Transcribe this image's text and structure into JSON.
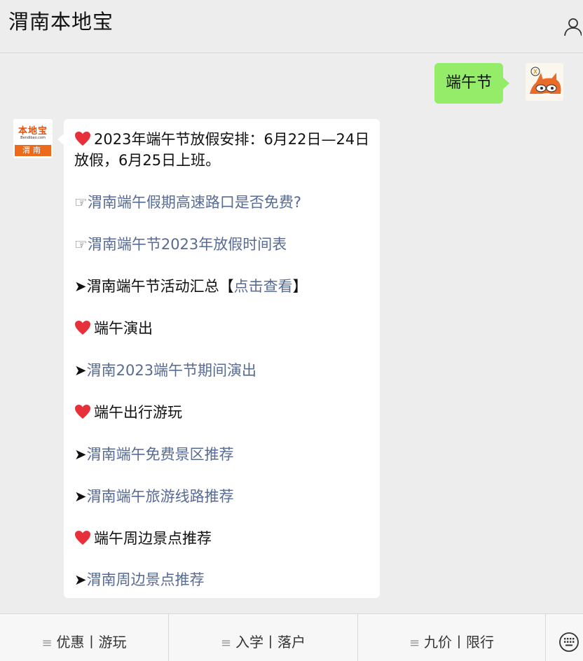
{
  "header": {
    "title": "渭南本地宝"
  },
  "user_message": {
    "text": "端午节"
  },
  "bot_avatar": {
    "brand": "本地宝",
    "sub": "Bendibao.com",
    "city": "渭南"
  },
  "bot_message": {
    "line1": "2023年端午节放假安排：6月22日—24日放假，6月25日上班。",
    "hand_glyph": "☞",
    "arrow_glyph": "➤",
    "link1": "渭南端午假期高速路口是否免费?",
    "link2": "渭南端午节2023年放假时间表",
    "activity_text": "渭南端午节活动汇总【",
    "activity_link": "点击查看",
    "activity_close": "】",
    "section1": "端午演出",
    "link3": "渭南2023端午节期间演出",
    "section2": "端午出行游玩",
    "link4": "渭南端午免费景区推荐",
    "link5": "渭南端午旅游线路推荐",
    "section3": "端午周边景点推荐",
    "link6": "渭南周边景点推荐"
  },
  "bottom_menu": {
    "item1": "优惠丨游玩",
    "item2": "入学丨落户",
    "item3": "九价丨限行"
  },
  "colors": {
    "link": "#576b95",
    "user_bubble": "#95ec69",
    "heart": "#e8303a",
    "brand_orange": "#ee6a1b"
  }
}
